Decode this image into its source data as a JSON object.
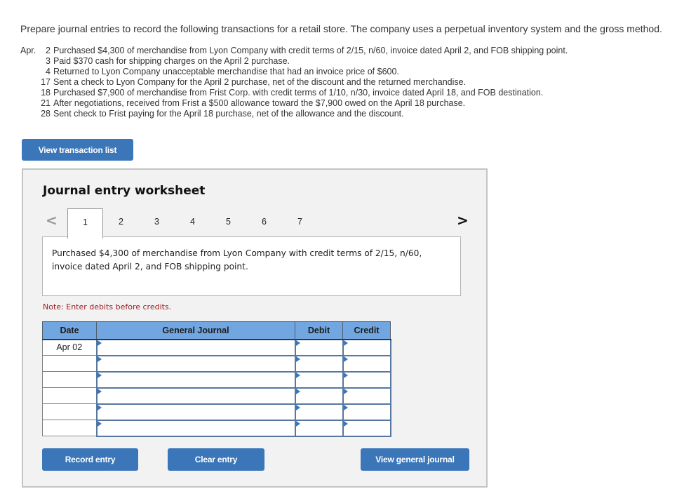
{
  "instructions": "Prepare journal entries to record the following transactions for a retail store. The company uses a perpetual inventory system and the gross method.",
  "transactions": [
    {
      "month": "Apr.",
      "day": "2",
      "text": "Purchased $4,300 of merchandise from Lyon Company with credit terms of 2/15, n/60, invoice dated April 2, and FOB shipping point."
    },
    {
      "month": "",
      "day": "3",
      "text": "Paid $370 cash for shipping charges on the April 2 purchase."
    },
    {
      "month": "",
      "day": "4",
      "text": "Returned to Lyon Company unacceptable merchandise that had an invoice price of $600."
    },
    {
      "month": "",
      "day": "17",
      "text": "Sent a check to Lyon Company for the April 2 purchase, net of the discount and the returned merchandise."
    },
    {
      "month": "",
      "day": "18",
      "text": "Purchased $7,900 of merchandise from Frist Corp. with credit terms of 1/10, n/30, invoice dated April 18, and FOB destination."
    },
    {
      "month": "",
      "day": "21",
      "text": "After negotiations, received from Frist a $500 allowance toward the $7,900 owed on the April 18 purchase."
    },
    {
      "month": "",
      "day": "28",
      "text": "Sent check to Frist paying for the April 18 purchase, net of the allowance and the discount."
    }
  ],
  "buttons": {
    "view_transaction_list": "View transaction list",
    "record_entry": "Record entry",
    "clear_entry": "Clear entry",
    "view_general_journal": "View general journal"
  },
  "worksheet": {
    "title": "Journal entry worksheet",
    "prev_icon": "chevron-left-icon",
    "next_icon": "chevron-right-icon",
    "prev_glyph": "<",
    "next_glyph": ">",
    "tabs": [
      "1",
      "2",
      "3",
      "4",
      "5",
      "6",
      "7"
    ],
    "active_tab": "1",
    "description": "Purchased $4,300 of merchandise from Lyon Company with credit terms of 2/15, n/60, invoice dated April 2, and FOB shipping point.",
    "note": "Note: Enter debits before credits."
  },
  "journal_table": {
    "headers": [
      "Date",
      "General Journal",
      "Debit",
      "Credit"
    ],
    "rows": [
      {
        "date": "Apr 02",
        "account": "",
        "debit": "",
        "credit": ""
      },
      {
        "date": "",
        "account": "",
        "debit": "",
        "credit": ""
      },
      {
        "date": "",
        "account": "",
        "debit": "",
        "credit": ""
      },
      {
        "date": "",
        "account": "",
        "debit": "",
        "credit": ""
      },
      {
        "date": "",
        "account": "",
        "debit": "",
        "credit": ""
      },
      {
        "date": "",
        "account": "",
        "debit": "",
        "credit": ""
      }
    ]
  },
  "colors": {
    "button_bg": "#3b76b9",
    "header_bg": "#72a6e0",
    "note_text": "#a02020",
    "panel_bg": "#f2f2f2"
  }
}
